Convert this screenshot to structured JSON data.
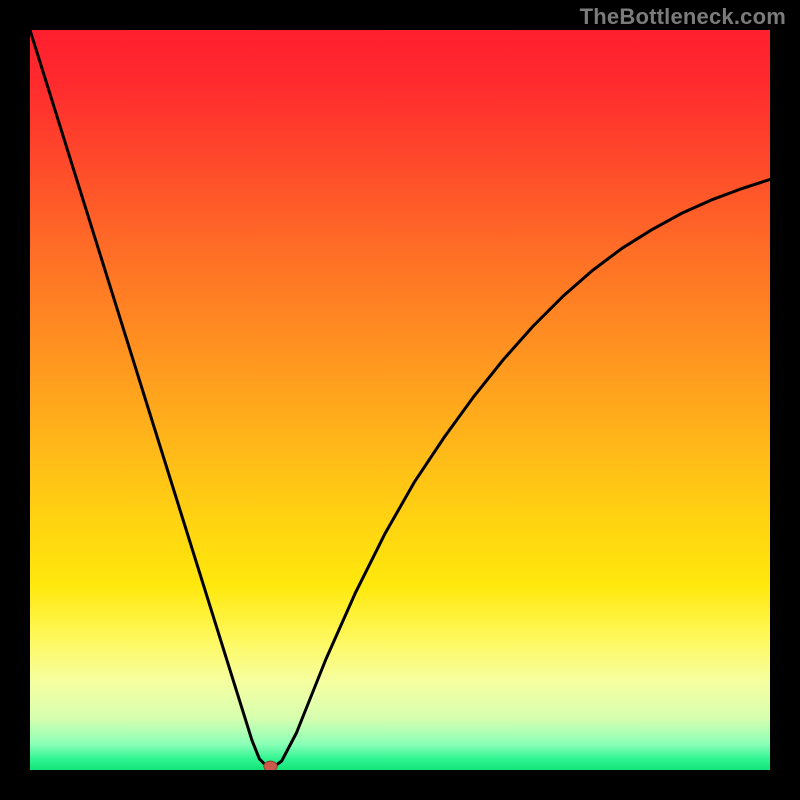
{
  "attribution": "TheBottleneck.com",
  "colors": {
    "frame": "#000000",
    "curve": "#000000",
    "marker_fill": "#cc5a4a",
    "marker_stroke": "#8f3f33",
    "gradient_stops": [
      {
        "offset": 0.0,
        "color": "#ff1f2e"
      },
      {
        "offset": 0.07,
        "color": "#ff2a2e"
      },
      {
        "offset": 0.18,
        "color": "#ff4a2b"
      },
      {
        "offset": 0.3,
        "color": "#ff6e26"
      },
      {
        "offset": 0.42,
        "color": "#ff8f21"
      },
      {
        "offset": 0.55,
        "color": "#ffb41a"
      },
      {
        "offset": 0.65,
        "color": "#ffd012"
      },
      {
        "offset": 0.75,
        "color": "#ffe80c"
      },
      {
        "offset": 0.82,
        "color": "#fff85a"
      },
      {
        "offset": 0.88,
        "color": "#f6ffa0"
      },
      {
        "offset": 0.93,
        "color": "#d7ffb0"
      },
      {
        "offset": 0.965,
        "color": "#8affb8"
      },
      {
        "offset": 0.985,
        "color": "#30f590"
      },
      {
        "offset": 1.0,
        "color": "#12e57a"
      }
    ]
  },
  "chart_data": {
    "type": "line",
    "title": "",
    "xlabel": "",
    "ylabel": "",
    "xlim": [
      0,
      100
    ],
    "ylim": [
      0,
      100
    ],
    "grid": false,
    "legend": false,
    "series": [
      {
        "name": "bottleneck_curve",
        "x": [
          0,
          4,
          8,
          12,
          16,
          20,
          24,
          26,
          28,
          29,
          30,
          31,
          32,
          33,
          34,
          36,
          38,
          40,
          44,
          48,
          52,
          56,
          60,
          64,
          68,
          72,
          76,
          80,
          84,
          88,
          92,
          96,
          100
        ],
        "y": [
          100,
          87.2,
          74.4,
          61.6,
          48.8,
          36.0,
          23.2,
          16.8,
          10.4,
          7.2,
          4.0,
          1.5,
          0.5,
          0.5,
          1.2,
          5.0,
          10.0,
          15.0,
          24.0,
          32.0,
          39.0,
          45.0,
          50.5,
          55.5,
          60.0,
          64.0,
          67.5,
          70.5,
          73.0,
          75.2,
          77.0,
          78.5,
          79.8
        ]
      }
    ],
    "marker": {
      "x": 32.5,
      "y": 0.5,
      "rx": 0.9,
      "ry": 0.7
    }
  }
}
